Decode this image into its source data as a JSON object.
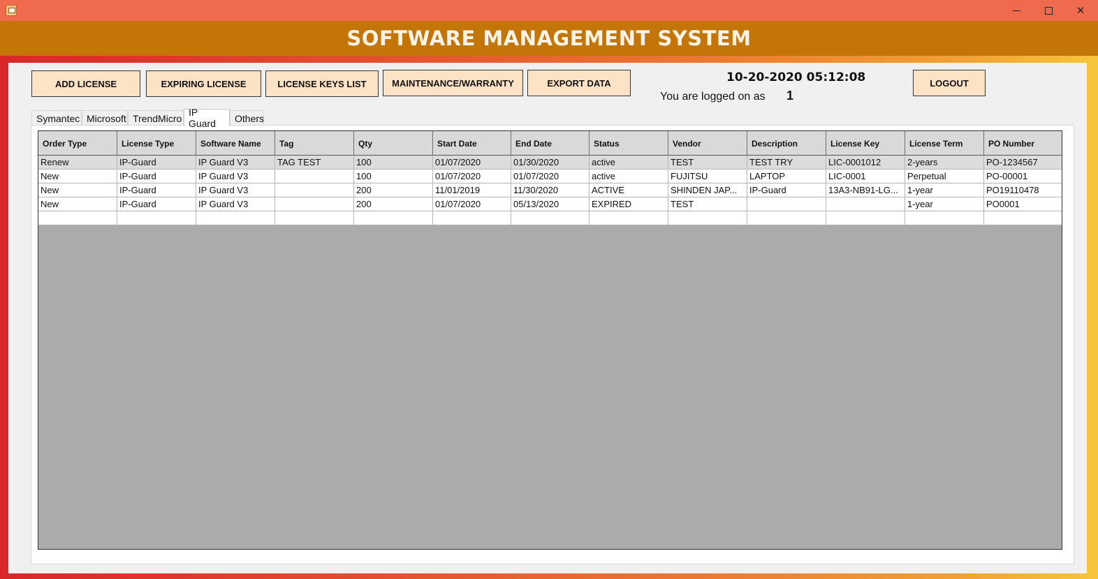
{
  "window": {
    "title": "",
    "controls": [
      "minimize-icon",
      "maximize-icon",
      "close-icon"
    ]
  },
  "header": {
    "title": "SOFTWARE MANAGEMENT SYSTEM"
  },
  "toolbar": {
    "add_license": "ADD LICENSE",
    "expiring_license": "EXPIRING LICENSE",
    "license_keys_list": "LICENSE KEYS LIST",
    "maintenance_warranty": "MAINTENANCE/WARRANTY",
    "export_data": "EXPORT DATA",
    "logout": "LOGOUT"
  },
  "session": {
    "datetime": "10-20-2020 05:12:08",
    "logged_label": "You are logged on as",
    "user": "1"
  },
  "tabs": [
    {
      "label": "Symantec"
    },
    {
      "label": "Microsoft"
    },
    {
      "label": "TrendMicro"
    },
    {
      "label": "IP Guard",
      "active": true
    },
    {
      "label": "Others"
    }
  ],
  "grid": {
    "columns": [
      "Order Type",
      "License Type",
      "Software Name",
      "Tag",
      "Qty",
      "Start Date",
      "End Date",
      "Status",
      "Vendor",
      "Description",
      "License Key",
      "License Term",
      "PO Number"
    ],
    "rows": [
      [
        "Renew",
        "IP-Guard",
        "IP Guard V3",
        "TAG TEST",
        "100",
        "01/07/2020",
        "01/30/2020",
        "active",
        "TEST",
        "TEST TRY",
        "LIC-0001012",
        "2-years",
        "PO-1234567"
      ],
      [
        "New",
        "IP-Guard",
        "IP Guard V3",
        "",
        "100",
        "01/07/2020",
        "01/07/2020",
        "active",
        "FUJITSU",
        "LAPTOP",
        "LIC-0001",
        "Perpetual",
        "PO-00001"
      ],
      [
        "New",
        "IP-Guard",
        "IP Guard V3",
        "",
        "200",
        "11/01/2019",
        "11/30/2020",
        "ACTIVE",
        "SHINDEN JAP...",
        "IP-Guard",
        "13A3-NB91-LG...",
        "1-year",
        "PO19110478"
      ],
      [
        "New",
        "IP-Guard",
        "IP Guard V3",
        "",
        "200",
        "01/07/2020",
        "05/13/2020",
        "EXPIRED",
        "TEST",
        "",
        "",
        "1-year",
        "PO0001"
      ],
      [
        "",
        "",
        "",
        "",
        "",
        "",
        "",
        "",
        "",
        "",
        "",
        "",
        ""
      ]
    ],
    "selected_row": 0
  },
  "colors": {
    "title_bar": "#f06a4e",
    "header_band": "#c47508",
    "button_fill": "#fde3c5",
    "grid_background": "#ababab"
  }
}
